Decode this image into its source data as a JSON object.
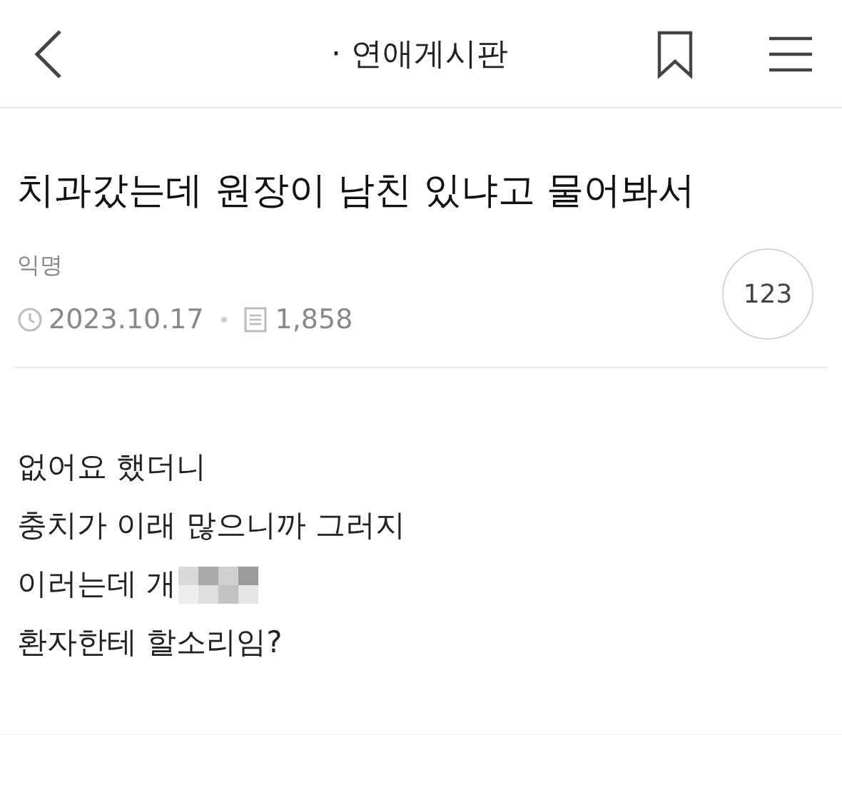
{
  "header": {
    "board_title": "· 연애게시판"
  },
  "post": {
    "title": "치과갔는데 원장이 남친 있냐고 물어봐서",
    "author": "익명",
    "date": "2023.10.17",
    "views": "1,858",
    "comment_count": "123",
    "body": [
      {
        "text": "없어요 했더니",
        "censored": false
      },
      {
        "text": "충치가 이래 많으니까 그러지",
        "censored": false
      },
      {
        "text": "이러는데 개",
        "censored": true
      },
      {
        "text": "환자한테 할소리임?",
        "censored": false
      }
    ]
  }
}
